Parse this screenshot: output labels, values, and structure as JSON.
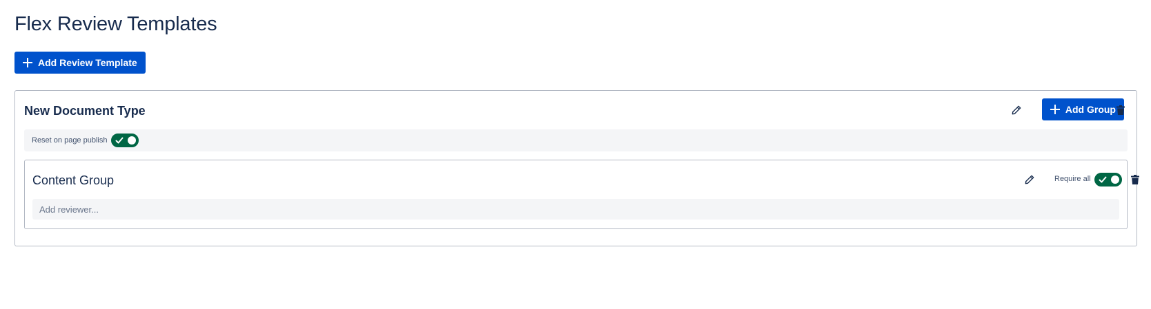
{
  "page": {
    "title": "Flex Review Templates",
    "add_template_label": "Add Review Template"
  },
  "template": {
    "name": "New Document Type",
    "add_group_label": "Add Group",
    "reset_label": "Reset on page publish",
    "reset_on_publish": true
  },
  "group": {
    "name": "Content Group",
    "require_all_label": "Require all",
    "require_all": true,
    "reviewer_value": "",
    "reviewer_placeholder": "Add reviewer..."
  },
  "colors": {
    "primary": "#0052cc",
    "toggle_on": "#006644",
    "border": "#b3b9c4",
    "row_bg": "#f4f5f7"
  },
  "icons": {
    "add": "plus-icon",
    "edit": "pencil-icon",
    "delete": "trash-icon",
    "toggle_check": "check-icon"
  }
}
